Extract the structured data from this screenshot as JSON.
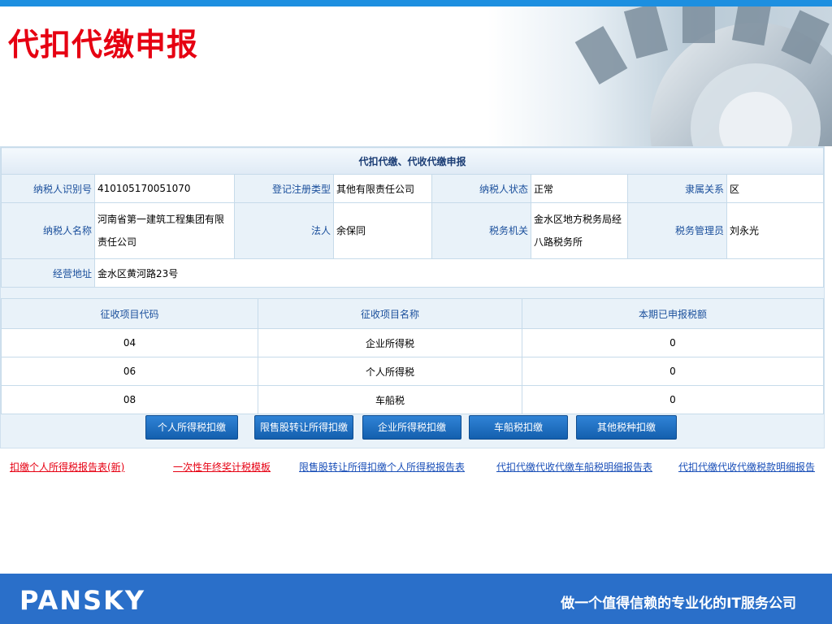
{
  "slide": {
    "title": "代扣代缴申报",
    "slogan": "做一个值得信赖的专业化的IT服务公司",
    "logo": "PANSKY"
  },
  "form": {
    "caption": "代扣代缴、代收代缴申报",
    "labels": {
      "taxpayer_id": "纳税人识别号",
      "reg_type": "登记注册类型",
      "taxpayer_status": "纳税人状态",
      "affiliation": "隶属关系",
      "taxpayer_name": "纳税人名称",
      "legal_person": "法人",
      "tax_office": "税务机关",
      "tax_manager": "税务管理员",
      "address": "经营地址"
    },
    "values": {
      "taxpayer_id": "410105170051070",
      "reg_type": "其他有限责任公司",
      "taxpayer_status": "正常",
      "affiliation": "区",
      "taxpayer_name": "河南省第一建筑工程集团有限责任公司",
      "legal_person": "余保同",
      "tax_office": "金水区地方税务局经八路税务所",
      "tax_manager": "刘永光",
      "address": "金水区黄河路23号"
    }
  },
  "items_table": {
    "headers": [
      "征收项目代码",
      "征收项目名称",
      "本期已申报税额"
    ],
    "rows": [
      [
        "04",
        "企业所得税",
        "0"
      ],
      [
        "06",
        "个人所得税",
        "0"
      ],
      [
        "08",
        "车船税",
        "0"
      ]
    ]
  },
  "buttons": [
    "个人所得税扣缴",
    "限售股转让所得扣缴",
    "企业所得税扣缴",
    "车船税扣缴",
    "其他税种扣缴"
  ],
  "links": [
    {
      "text": "扣缴个人所得税报告表(新)",
      "color": "#e60012"
    },
    {
      "text": "一次性年终奖计税模板",
      "color": "#e60012"
    },
    {
      "text": "限售股转让所得扣缴个人所得税报告表",
      "color": "#1a4fb8"
    },
    {
      "text": "代扣代缴代收代缴车船税明细报告表",
      "color": "#1a4fb8"
    },
    {
      "text": "代扣代缴代收代缴税款明细报告",
      "color": "#1a4fb8"
    }
  ],
  "colors": {
    "accent_red": "#e60012",
    "header_blue": "#1d8fe0",
    "footer_blue": "#2a6fc9",
    "label_blue": "#1a4f9c"
  }
}
